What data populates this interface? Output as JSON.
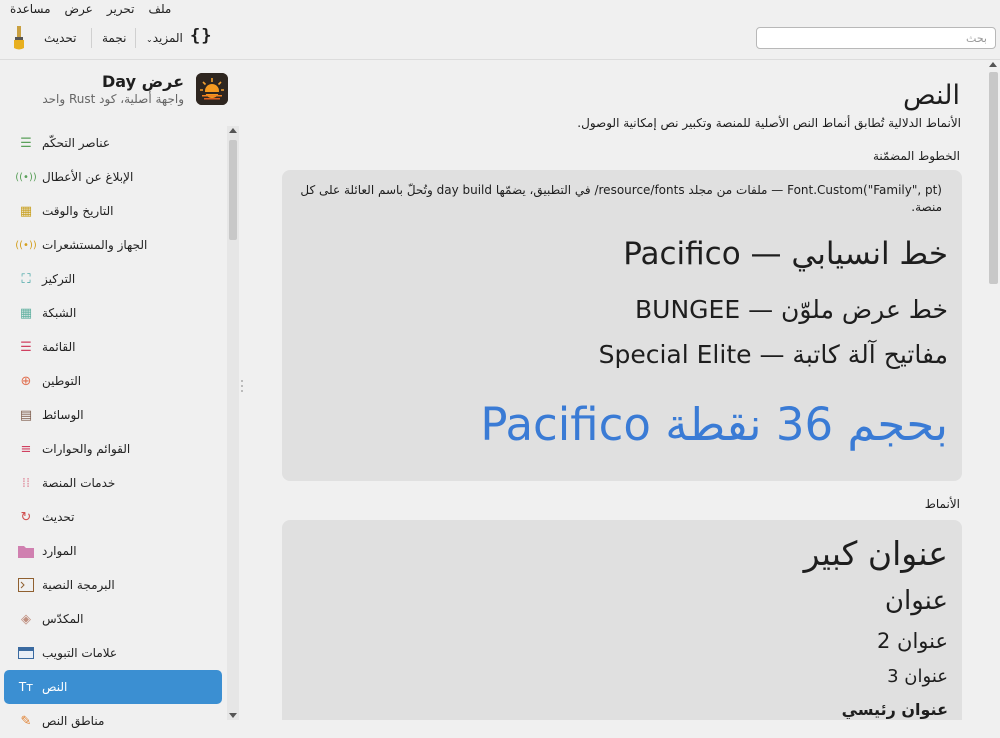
{
  "menu": {
    "file": "ملف",
    "edit": "تحرير",
    "view": "عرض",
    "help": "مساعدة"
  },
  "toolbar": {
    "update_label": "تحديث",
    "star_label": "نجمة",
    "more_label": "المزيد",
    "braces_label": "{}"
  },
  "search": {
    "placeholder": "بحث"
  },
  "app": {
    "title": "عرض Day",
    "subtitle": "واجهة أصلية، كود Rust واحد"
  },
  "sidebar": {
    "items": [
      {
        "label": "عناصر التحكّم",
        "icon": "sliders-icon",
        "color": "#5aa05a"
      },
      {
        "label": "الإبلاغ عن الأعطال",
        "icon": "broadcast-icon",
        "color": "#5aa05a"
      },
      {
        "label": "التاريخ والوقت",
        "icon": "calendar-icon",
        "color": "#c9a020"
      },
      {
        "label": "الجهاز والمستشعرات",
        "icon": "sensor-icon",
        "color": "#d4a020"
      },
      {
        "label": "التركيز",
        "icon": "focus-icon",
        "color": "#3aa0a0"
      },
      {
        "label": "الشبكة",
        "icon": "grid-icon",
        "color": "#60b0a0"
      },
      {
        "label": "القائمة",
        "icon": "list-icon",
        "color": "#d04060"
      },
      {
        "label": "التوطين",
        "icon": "globe-icon",
        "color": "#e07050"
      },
      {
        "label": "الوسائط",
        "icon": "clapper-icon",
        "color": "#806050"
      },
      {
        "label": "القوائم والحوارات",
        "icon": "menu-icon",
        "color": "#d04060"
      },
      {
        "label": "خدمات المنصة",
        "icon": "dots-icon",
        "color": "#e090a0"
      },
      {
        "label": "تحديث",
        "icon": "refresh-icon",
        "color": "#d05050"
      },
      {
        "label": "الموارد",
        "icon": "folder-icon",
        "color": "#d080b0"
      },
      {
        "label": "البرمجة النصية",
        "icon": "terminal-icon",
        "color": "#906030"
      },
      {
        "label": "المكدّس",
        "icon": "stack-icon",
        "color": "#c09080"
      },
      {
        "label": "علامات التبويب",
        "icon": "tabs-icon",
        "color": "#3a6aa0"
      },
      {
        "label": "النص",
        "icon": "text-icon",
        "color": "#ffffff"
      },
      {
        "label": "مناطق النص",
        "icon": "edit-icon",
        "color": "#e08030"
      }
    ],
    "active_index": 16
  },
  "main": {
    "title": "النص",
    "description": "الأنماط الدلالية تُطابق أنماط النص الأصلية للمنصة وتكبير نص إمكانية الوصول.",
    "embedded_section": "الخطوط المضمّنة",
    "embedded_note": "Font.Custom(\"Family\", pt) — ملفات من مجلد resource/fonts/ في التطبيق، يضمّها day build وتُحلّ باسم العائلة على كل منصة.",
    "pacifico_line": "خط انسيابي — Pacifico",
    "bungee_line": "خط عرض ملوّن — BUNGEE",
    "elite_line": "مفاتيح آلة كاتبة — Special Elite",
    "size_line": "بحجم 36 نقطة Pacifico",
    "styles_section": "الأنماط",
    "styles": {
      "large_title": "عنوان كبير",
      "title": "عنوان",
      "title2": "عنوان 2",
      "title3": "عنوان 3",
      "headline": "عنوان رئيسي"
    }
  },
  "colors": {
    "accent": "#3b8fd2",
    "pacifico_blue": "#3a7bd5",
    "card_bg": "#e0e0e0"
  }
}
